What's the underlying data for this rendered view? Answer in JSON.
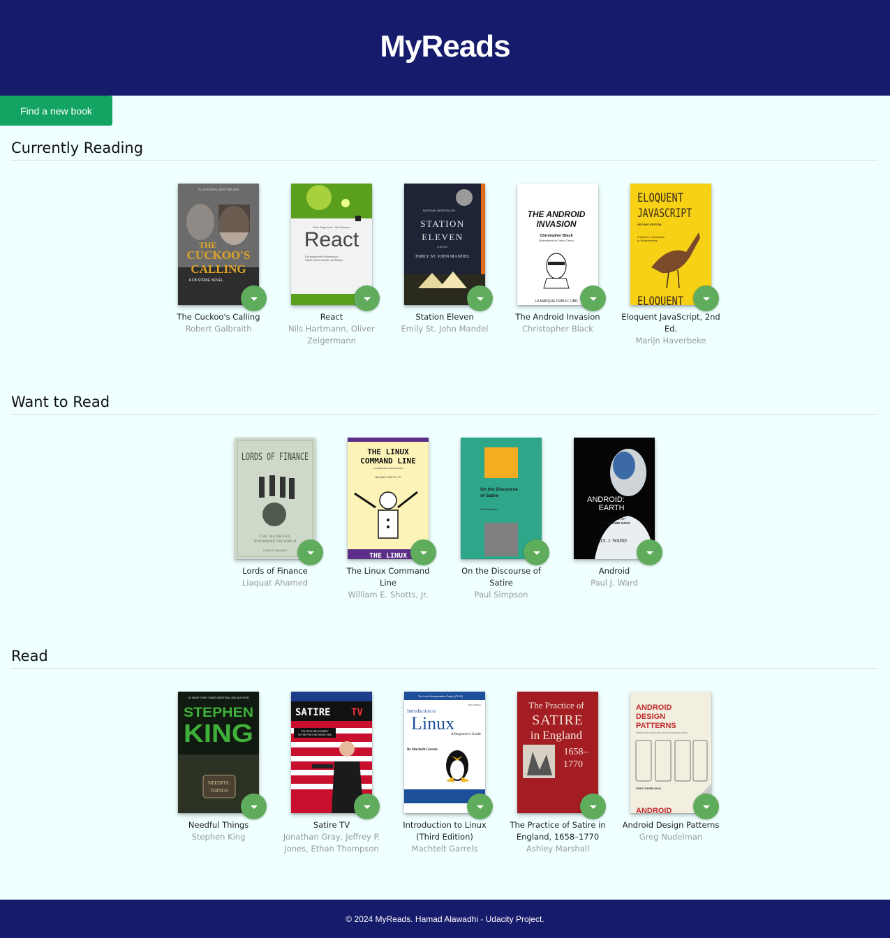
{
  "app": {
    "title": "MyReads"
  },
  "actions": {
    "find_label": "Find a new book"
  },
  "shelves": [
    {
      "title": "Currently Reading",
      "books": [
        {
          "title": "The Cuckoo's Calling",
          "authors": "Robert Galbraith"
        },
        {
          "title": "React",
          "authors": "Nils Hartmann, Oliver Zeigermann"
        },
        {
          "title": "Station Eleven",
          "authors": "Emily St. John Mandel"
        },
        {
          "title": "The Android Invasion",
          "authors": "Christopher Black"
        },
        {
          "title": "Eloquent JavaScript, 2nd Ed.",
          "authors": "Marijn Haverbeke"
        }
      ]
    },
    {
      "title": "Want to Read",
      "books": [
        {
          "title": "Lords of Finance",
          "authors": "Liaquat Ahamed"
        },
        {
          "title": "The Linux Command Line",
          "authors": "William E. Shotts, Jr."
        },
        {
          "title": "On the Discourse of Satire",
          "authors": "Paul Simpson"
        },
        {
          "title": "Android",
          "authors": "Paul J. Ward"
        }
      ]
    },
    {
      "title": "Read",
      "books": [
        {
          "title": "Needful Things",
          "authors": "Stephen King"
        },
        {
          "title": "Satire TV",
          "authors": "Jonathan Gray, Jeffrey P. Jones, Ethan Thompson"
        },
        {
          "title": "Introduction to Linux (Third Edition)",
          "authors": "Machtelt Garrels"
        },
        {
          "title": "The Practice of Satire in England, 1658–1770",
          "authors": "Ashley Marshall"
        },
        {
          "title": "Android Design Patterns",
          "authors": "Greg Nudelman"
        }
      ]
    }
  ],
  "covers": {
    "cuckoo": {
      "line1": "THE",
      "line2": "CUCKOO'S",
      "line3": "CALLING",
      "sub": "A CB STRIKE NOVEL",
      "top": "#1 NATIONAL BESTSELLER"
    },
    "react": {
      "title": "React",
      "authors": "Oliver Zeigermann · Nils Hartmann",
      "sub1": "Die praktische Einführung in",
      "sub2": "React, React Router und Redux"
    },
    "station": {
      "top": "NATIONAL BESTSELLER",
      "line1": "STATION",
      "line2": "ELEVEN",
      "novel": "A NOVEL",
      "author": "EMILY ST. JOHN MANDEL"
    },
    "android_inv": {
      "line1": "THE ANDROID",
      "line2": "INVASION",
      "author": "Christopher Black",
      "sub": "Illustrations by Fabio Cinton",
      "footer": "LA MARQUE PUBLIC LIBR"
    },
    "eloquent": {
      "line1": "ELOQUENT",
      "line2": "JAVASCRIPT",
      "edition": "SECOND EDITION",
      "sub1": "A Modern Introduction",
      "sub2": "to Programming",
      "bottom": "ELOQUENT"
    },
    "lords": {
      "title": "LORDS OF FINANCE",
      "sub1": "THE BANKERS",
      "sub2": "WHO BROKE THE WORLD",
      "author": "LIAQUAT AHAMED"
    },
    "linux_cmd": {
      "line1": "THE LINUX",
      "line2": "COMMAND LINE",
      "sub": "A COMPLETE INTRODUCTION",
      "author": "WILLIAM E. SHOTTS, JR.",
      "bottom": "THE LINUX"
    },
    "discourse": {
      "line1": "On the Discourse",
      "line2": "of Satire",
      "author": "Paul Simpson"
    },
    "android_earth": {
      "line1": "ANDROID:",
      "line2": "EARTH",
      "sub1": "BOOK ONE OF",
      "sub2": "THE ANDROID SAGA",
      "author": "PAUL J. WARD"
    },
    "needful": {
      "top": "#1 NEW YORK TIMES BESTSELLING AUTHOR",
      "line1": "STEPHEN",
      "line2": "KING",
      "sign1": "NEEDFUL",
      "sign2": "THINGS"
    },
    "satire_tv": {
      "title": "SATIRE",
      "tv": "TV",
      "sub1": "POLITICS AND COMEDY",
      "sub2": "IN THE POST-NETWORK ERA"
    },
    "intro_linux": {
      "top": "The Linux Documentation Project (TLDP)",
      "line1": "Introduction to",
      "line2": "Linux",
      "sub": "A Beginner's Guide",
      "edition": "Third Edition",
      "author": "By Machtelt Garrels"
    },
    "practice": {
      "line1": "The Practice of",
      "line2": "SATIRE",
      "line3": "in England",
      "line4": "1658–",
      "line5": "1770"
    },
    "android_design": {
      "line1": "ANDROID",
      "line2": "DESIGN",
      "line3": "PATTERNS",
      "sub": "INTERACTION DESIGN SOLUTIONS FOR DEVELOPERS",
      "author": "GREG NUDELMAN",
      "bottom": "ANDROID"
    }
  },
  "footer": {
    "text": "© 2024 MyReads. Hamad Alawadhi - Udacity Project."
  }
}
